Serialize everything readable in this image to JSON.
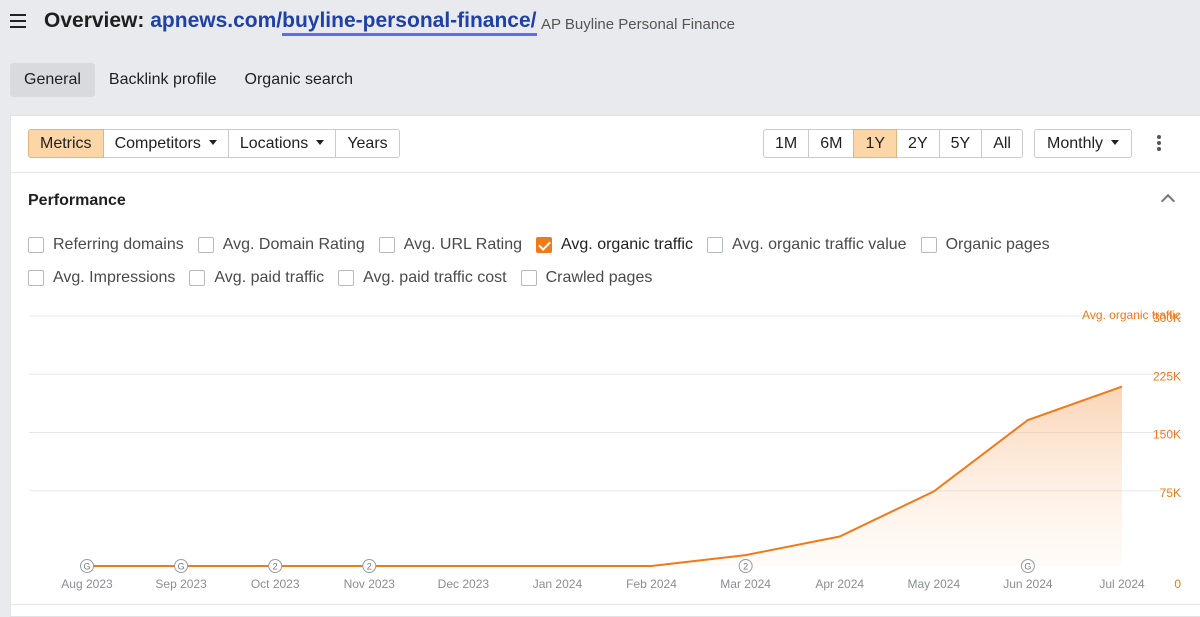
{
  "header": {
    "title_label": "Overview:",
    "url_domain": "apnews.com/",
    "url_path": "buyline-personal-finance/",
    "subtitle": "AP Buyline Personal Finance"
  },
  "tabs": [
    {
      "label": "General",
      "active": true
    },
    {
      "label": "Backlink profile",
      "active": false
    },
    {
      "label": "Organic search",
      "active": false
    }
  ],
  "toolbar": {
    "metrics": "Metrics",
    "competitors": "Competitors",
    "locations": "Locations",
    "years": "Years"
  },
  "periods": [
    "1M",
    "6M",
    "1Y",
    "2Y",
    "5Y",
    "All"
  ],
  "selected_period": "1Y",
  "interval": "Monthly",
  "performance": {
    "title": "Performance",
    "metrics_row1": [
      {
        "label": "Referring domains",
        "checked": false
      },
      {
        "label": "Avg. Domain Rating",
        "checked": false
      },
      {
        "label": "Avg. URL Rating",
        "checked": false
      },
      {
        "label": "Avg. organic traffic",
        "checked": true
      },
      {
        "label": "Avg. organic traffic value",
        "checked": false
      },
      {
        "label": "Organic pages",
        "checked": false
      }
    ],
    "metrics_row2": [
      {
        "label": "Avg. Impressions",
        "checked": false
      },
      {
        "label": "Avg. paid traffic",
        "checked": false
      },
      {
        "label": "Avg. paid traffic cost",
        "checked": false
      },
      {
        "label": "Crawled pages",
        "checked": false
      }
    ]
  },
  "colors": {
    "accent": "#ee7a1a",
    "link": "#1e40a8",
    "selected_bg": "#fcd6a6"
  },
  "chart_data": {
    "type": "area",
    "series": [
      {
        "name": "Avg. organic traffic",
        "values": [
          0,
          0,
          0,
          0,
          0,
          0,
          0,
          14000,
          38000,
          96000,
          188000,
          231000
        ]
      }
    ],
    "categories": [
      "Aug 2023",
      "Sep 2023",
      "Oct 2023",
      "Nov 2023",
      "Dec 2023",
      "Jan 2024",
      "Feb 2024",
      "Mar 2024",
      "Apr 2024",
      "May 2024",
      "Jun 2024",
      "Jul 2024"
    ],
    "y_ticks": [
      "0",
      "75K",
      "150K",
      "225K",
      "300K"
    ],
    "ylim": [
      0,
      300000
    ],
    "y_axis_side": "right",
    "grid": true,
    "annotations": [
      {
        "category": "Aug 2023",
        "label": "G"
      },
      {
        "category": "Sep 2023",
        "label": "G"
      },
      {
        "category": "Oct 2023",
        "label": "2"
      },
      {
        "category": "Nov 2023",
        "label": "2"
      },
      {
        "category": "Mar 2024",
        "label": "2"
      },
      {
        "category": "Jun 2024",
        "label": "G"
      }
    ]
  }
}
